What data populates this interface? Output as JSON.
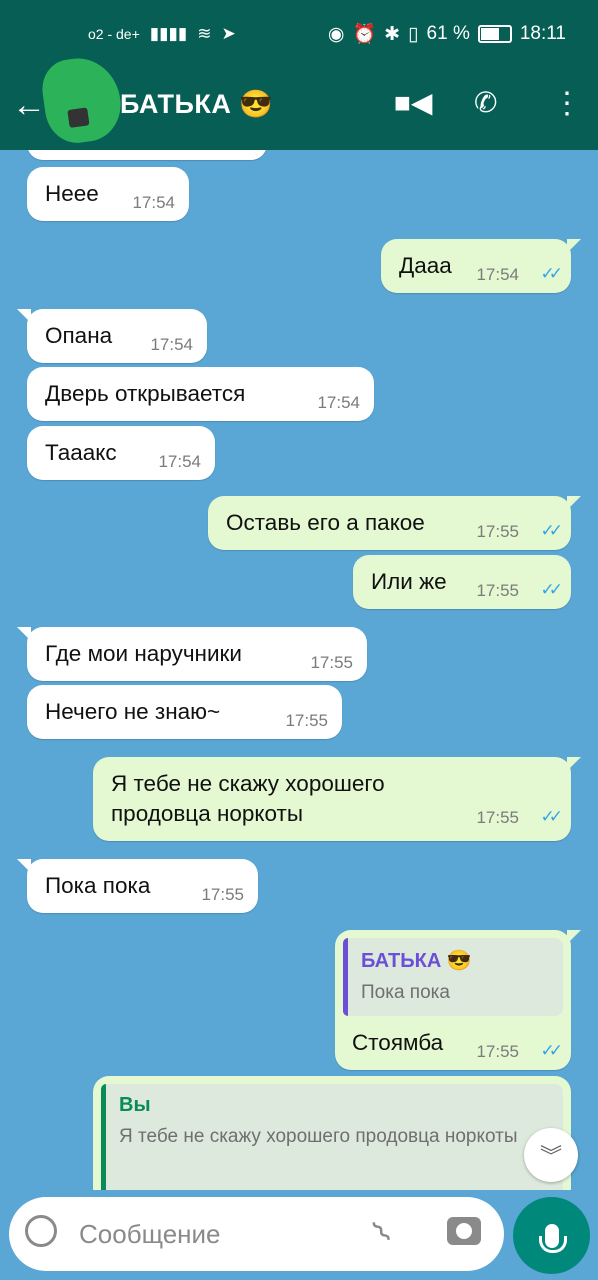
{
  "status_bar": {
    "carrier": "o2 - de+",
    "battery_percent": "61 %",
    "time": "18:11"
  },
  "header": {
    "contact_name": "БАТЬКА 😎",
    "back_icon": "arrow-left-icon",
    "video_icon": "video-call-icon",
    "call_icon": "phone-icon",
    "more_icon": "more-vert-icon"
  },
  "messages": [
    {
      "dir": "in",
      "text": "Неее",
      "time": "17:54"
    },
    {
      "dir": "out",
      "text": "Дааа",
      "time": "17:54",
      "read": true
    },
    {
      "dir": "in",
      "text": "Опана",
      "time": "17:54"
    },
    {
      "dir": "in",
      "text": "Дверь открывается",
      "time": "17:54"
    },
    {
      "dir": "in",
      "text": "Тааакс",
      "time": "17:54"
    },
    {
      "dir": "out",
      "text": "Оставь его а пакое",
      "time": "17:55",
      "read": true
    },
    {
      "dir": "out",
      "text": "Или же",
      "time": "17:55",
      "read": true
    },
    {
      "dir": "in",
      "text": "Где мои наручники",
      "time": "17:55"
    },
    {
      "dir": "in",
      "text": "Нечего не знаю~",
      "time": "17:55"
    },
    {
      "dir": "out",
      "text": "Я тебе не скажу хорошего продовца норкоты",
      "time": "17:55",
      "read": true
    },
    {
      "dir": "in",
      "text": "Пока пока",
      "time": "17:55"
    },
    {
      "dir": "out",
      "text": "Стоямба",
      "time": "17:55",
      "read": true,
      "quote": {
        "name": "БАТЬКА 😎",
        "text": "Пока пока"
      }
    },
    {
      "dir": "out",
      "text": "",
      "time": "",
      "quote": {
        "name": "Вы",
        "text": "Я тебе не скажу хорошего продовца норкоты"
      }
    }
  ],
  "composer": {
    "placeholder": "Сообщение",
    "emoji_icon": "emoji-icon",
    "attach_icon": "paperclip-icon",
    "camera_icon": "camera-icon",
    "mic_icon": "microphone-icon"
  },
  "colors": {
    "header": "#075e54",
    "outgoing_bubble": "#e4f8d1",
    "incoming_bubble": "#ffffff",
    "read_ticks": "#34a4e9",
    "quote_purple": "#6c4fd8",
    "quote_green": "#0a8a57",
    "mic_button": "#00897b"
  }
}
